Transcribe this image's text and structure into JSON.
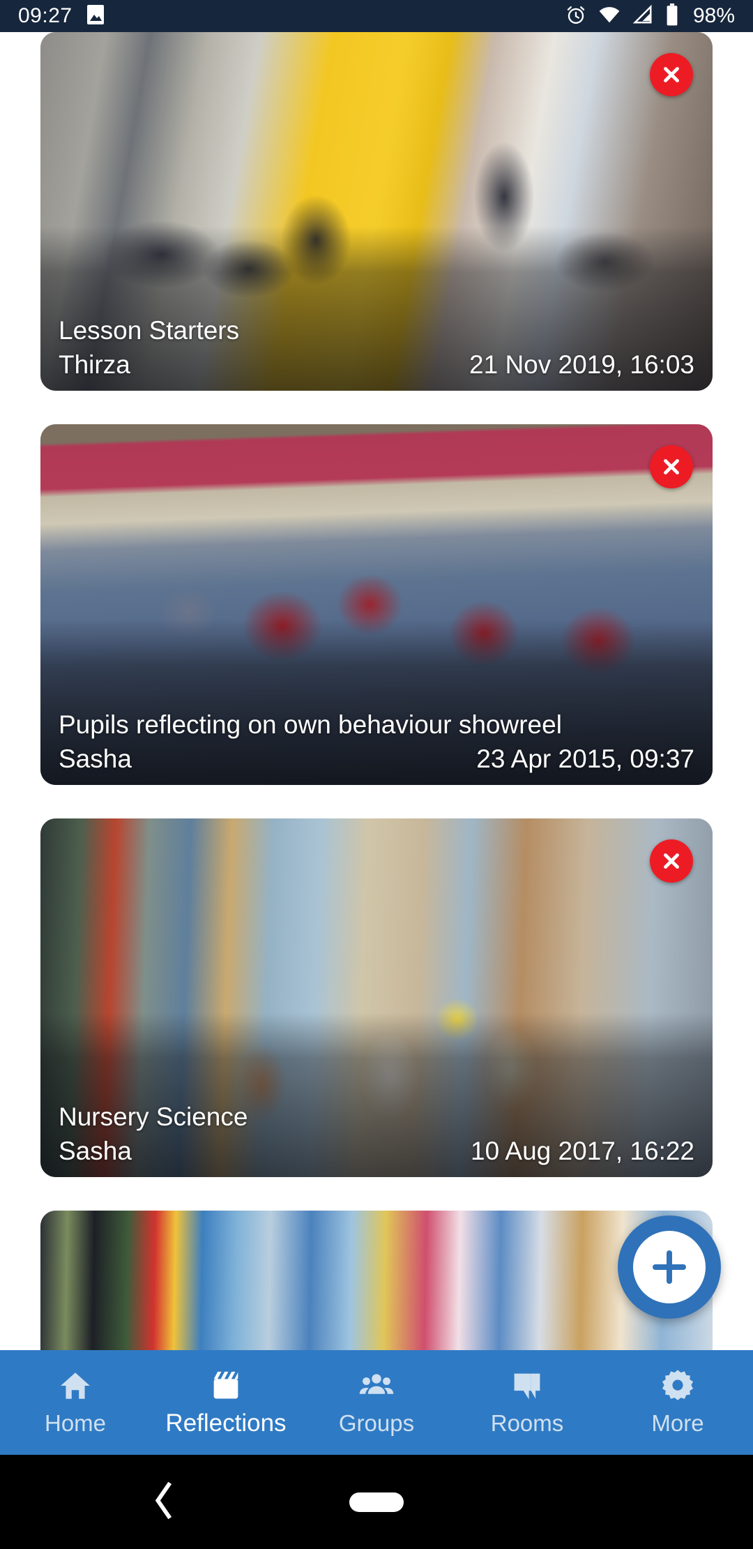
{
  "status_bar": {
    "time": "09:27",
    "battery_text": "98%",
    "icons": [
      "image-icon",
      "alarm-icon",
      "wifi-icon",
      "signal-icon",
      "battery-icon"
    ],
    "background_color": "#16263c"
  },
  "theme": {
    "accent_blue": "#2f7ac4",
    "fab_blue": "#2f72b9",
    "delete_red": "#ed1c24",
    "page_background": "#ffffff"
  },
  "main": {
    "screen": "Reflections",
    "cards": [
      {
        "title": "Lesson Starters",
        "author": "Thirza",
        "date": "21 Nov 2019, 16:03",
        "delete_label": "x"
      },
      {
        "title": "Pupils reflecting on own behaviour showreel",
        "author": "Sasha",
        "date": "23 Apr 2015, 09:37",
        "delete_label": "x"
      },
      {
        "title": "Nursery Science",
        "author": "Sasha",
        "date": "10 Aug 2017, 16:22",
        "delete_label": "x"
      },
      {
        "title": "",
        "author": "",
        "date": "",
        "delete_label": ""
      }
    ]
  },
  "fab": {
    "icon": "plus-icon",
    "label": "Add"
  },
  "bottom_nav": {
    "items": [
      {
        "label": "Home",
        "icon": "home-icon",
        "active": false
      },
      {
        "label": "Reflections",
        "icon": "clapperboard-icon",
        "active": true
      },
      {
        "label": "Groups",
        "icon": "people-icon",
        "active": false
      },
      {
        "label": "Rooms",
        "icon": "chat-bubble-icon",
        "active": false
      },
      {
        "label": "More",
        "icon": "gear-icon",
        "active": false
      }
    ]
  },
  "system_nav": {
    "back_icon": "chevron-left-icon",
    "home_icon": "home-pill-icon"
  }
}
